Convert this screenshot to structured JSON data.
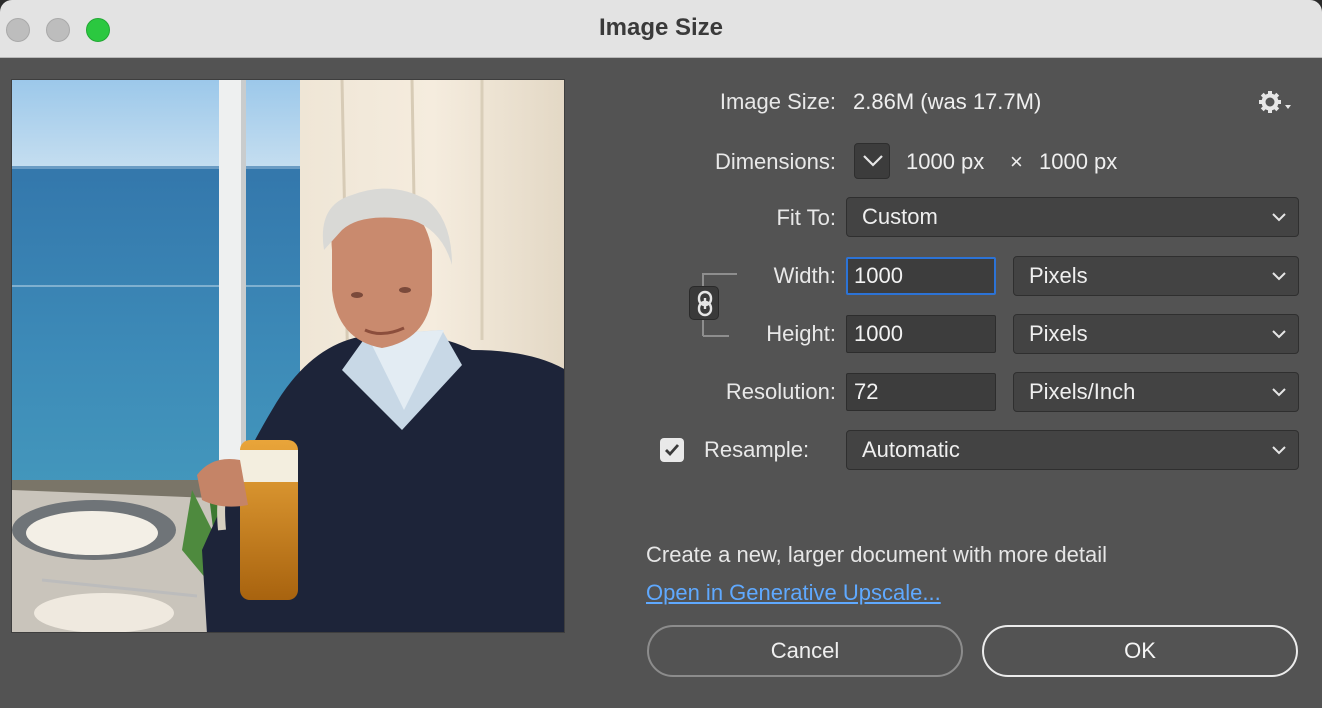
{
  "window": {
    "title": "Image Size",
    "traffic_lights": [
      "close",
      "minimize",
      "maximize"
    ]
  },
  "info": {
    "image_size_label": "Image Size:",
    "image_size_value": "2.86M (was 17.7M)",
    "settings_icon": "gear-icon",
    "dimensions_label": "Dimensions:",
    "dimensions_width": "1000 px",
    "dimensions_x": "×",
    "dimensions_height": "1000 px"
  },
  "fit_to": {
    "label": "Fit To:",
    "value": "Custom"
  },
  "width": {
    "label": "Width:",
    "value": "1000",
    "unit": "Pixels"
  },
  "height": {
    "label": "Height:",
    "value": "1000",
    "unit": "Pixels"
  },
  "resolution": {
    "label": "Resolution:",
    "value": "72",
    "unit": "Pixels/Inch"
  },
  "resample": {
    "checked": true,
    "label": "Resample:",
    "value": "Automatic"
  },
  "upscale": {
    "description": "Create a new, larger document with more detail",
    "link": "Open in Generative Upscale..."
  },
  "buttons": {
    "cancel": "Cancel",
    "ok": "OK"
  },
  "colors": {
    "dialog_bg": "#535353",
    "titlebar_bg": "#e3e3e3",
    "focus_ring": "#2c73d6",
    "link": "#5fa9ff",
    "maximize_green": "#2bc840"
  }
}
